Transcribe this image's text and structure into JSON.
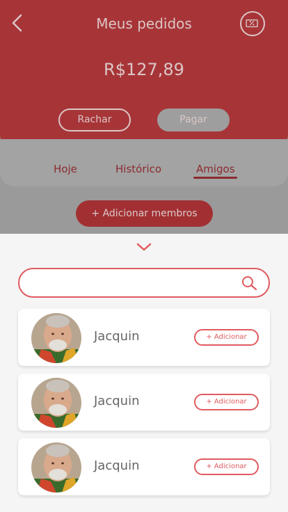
{
  "header": {
    "title": "Meus pedidos",
    "amount": "R$127,89",
    "split_label": "Rachar",
    "pay_label": "Pagar"
  },
  "tabs": [
    {
      "label": "Hoje"
    },
    {
      "label": "Histórico"
    },
    {
      "label": "Amigos"
    }
  ],
  "add_members_label": "+ Adicionar membros",
  "search": {
    "placeholder": ""
  },
  "friends": [
    {
      "name": "Jacquin",
      "action": "+ Adicionar"
    },
    {
      "name": "Jacquin",
      "action": "+ Adicionar"
    },
    {
      "name": "Jacquin",
      "action": "+ Adicionar"
    }
  ],
  "colors": {
    "brand": "#e05a5e",
    "header_dim": "#a73538"
  }
}
